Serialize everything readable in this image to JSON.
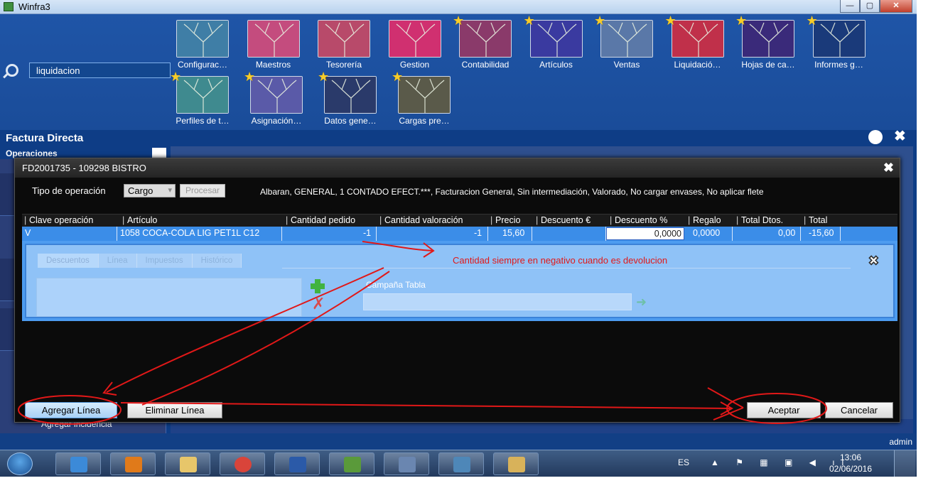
{
  "window": {
    "title": "Winfra3",
    "minimize": "—",
    "maximize": "▢",
    "close": "✕"
  },
  "search": {
    "value": "liquidacion"
  },
  "tiles_row1": [
    {
      "label": "Configurac…",
      "star": false,
      "color": "#3f7ea6"
    },
    {
      "label": "Maestros",
      "star": false,
      "color": "#c44c7e"
    },
    {
      "label": "Tesorería",
      "star": false,
      "color": "#b84a6a"
    },
    {
      "label": "Gestion",
      "star": false,
      "color": "#d03070"
    },
    {
      "label": "Contabilidad",
      "star": true,
      "color": "#8a3a6a"
    },
    {
      "label": "Artículos",
      "star": true,
      "color": "#3a3aa0"
    },
    {
      "label": "Ventas",
      "star": true,
      "color": "#5a78a8"
    },
    {
      "label": "Liquidació…",
      "star": true,
      "color": "#c0304a"
    },
    {
      "label": "Hojas de ca…",
      "star": true,
      "color": "#3a2a7a"
    },
    {
      "label": "Informes g…",
      "star": true,
      "color": "#1a3a7a"
    }
  ],
  "tiles_row2": [
    {
      "label": "Perfiles de t…",
      "star": true,
      "color": "#3f8a8f"
    },
    {
      "label": "Asignación…",
      "star": true,
      "color": "#5a5aa8"
    },
    {
      "label": "Datos gene…",
      "star": true,
      "color": "#2a3a6a"
    },
    {
      "label": "Cargas pre…",
      "star": true,
      "color": "#5a5a4a"
    }
  ],
  "factura": {
    "title": "Factura Directa",
    "operaciones": "Operaciones",
    "agregar_incidencia": "Agregar incidencia"
  },
  "dialog": {
    "title": "FD2001735 - 109298 BISTRO",
    "close": "✖",
    "tipo_label": "Tipo de operación",
    "tipo_value": "Cargo",
    "procesar": "Procesar",
    "description": "Albaran, GENERAL, 1 CONTADO EFECT.***, Facturacion General, Sin intermediación, Valorado, No cargar envases, No aplicar flete",
    "columns": [
      "Clave operación",
      "Artículo",
      "Cantidad pedido",
      "Cantidad valoración",
      "Precio",
      "Descuento €",
      "Descuento %",
      "Regalo",
      "Total Dtos.",
      "Total"
    ],
    "row": {
      "clave": "V",
      "articulo": "1058 COCA-COLA LIG PET1L C12",
      "cantidad_pedido": "-1",
      "cantidad_valoracion": "-1",
      "precio": "15,60",
      "descuento_eur": "",
      "descuento_pct": "0,0000",
      "regalo": "0,0000",
      "total_dtos": "0,00",
      "total": "-15,60"
    },
    "tabs": [
      "Descuentos",
      "Línea",
      "Impuestos",
      "Histórico"
    ],
    "note": "Cantidad siempre en negativo cuando es devolucion",
    "campana_label": "Campaña Tabla",
    "buttons": {
      "agregar": "Agregar Línea",
      "eliminar": "Eliminar Línea",
      "aceptar": "Aceptar",
      "cancelar": "Cancelar"
    }
  },
  "status_user": "admin",
  "tray": {
    "lang": "ES",
    "time": "13:06",
    "date": "02/06/2016"
  },
  "colors": {
    "desktop": "#0e3d86",
    "annotation": "#e11818",
    "selected_row": "#3b8de8"
  }
}
